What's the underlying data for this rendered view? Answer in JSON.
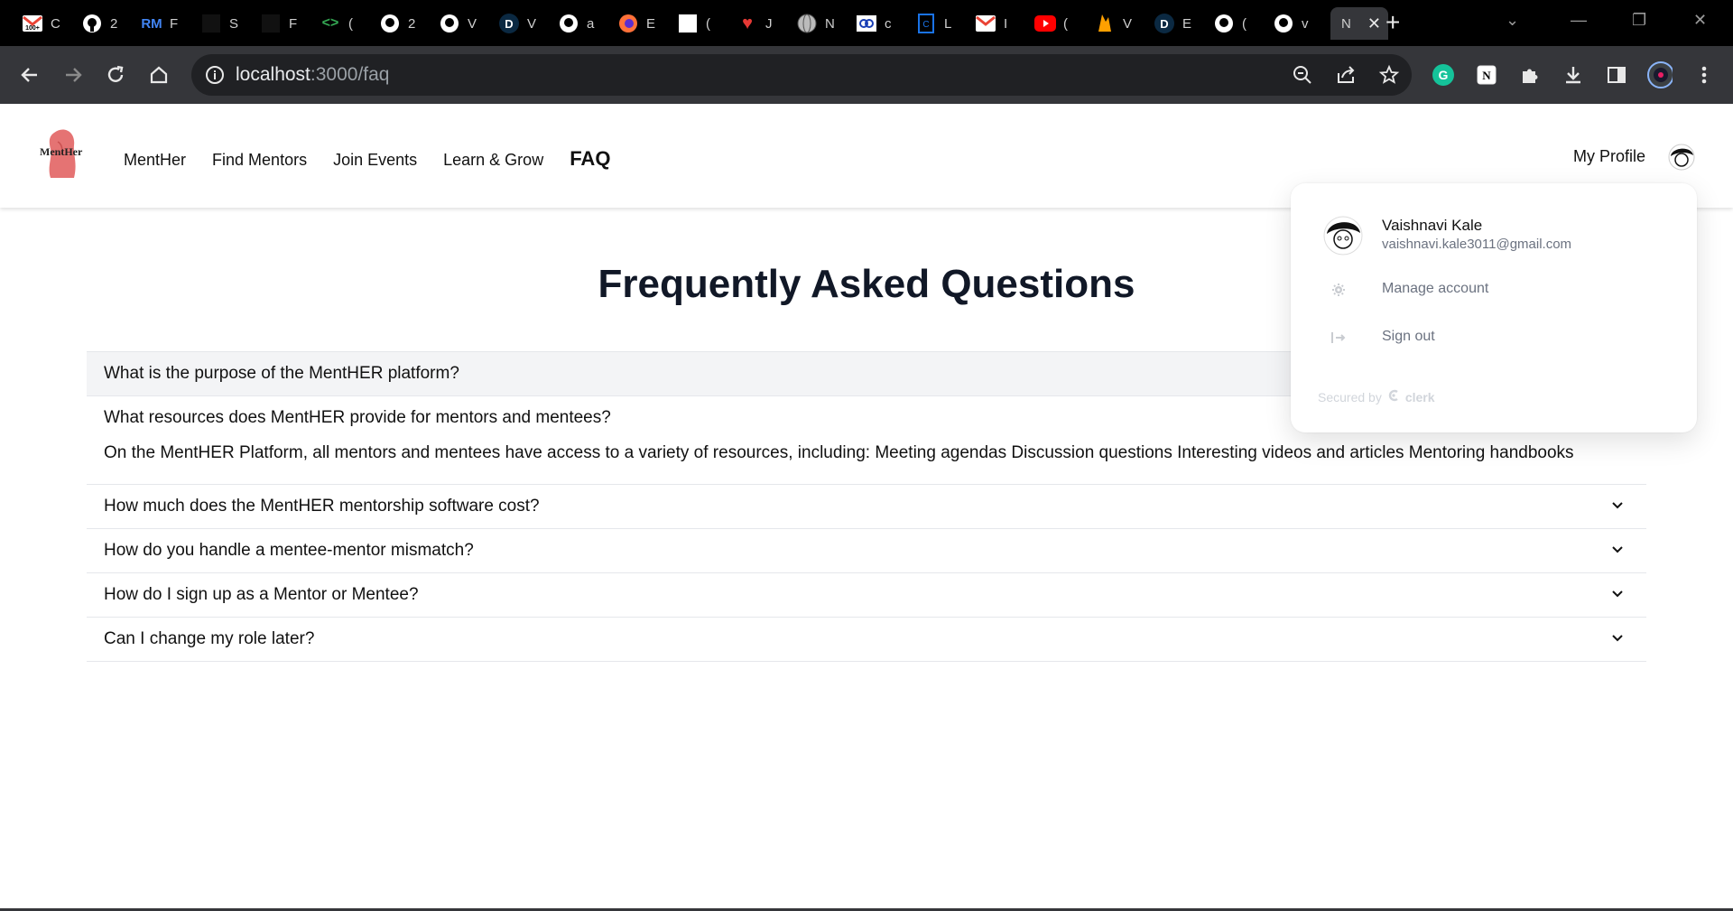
{
  "browser": {
    "tabs": [
      {
        "icon": "gmail-icon",
        "title": "C"
      },
      {
        "icon": "github-icon",
        "title": "2"
      },
      {
        "icon": "rm-icon",
        "title": "F"
      },
      {
        "icon": "dark-page-icon",
        "title": "S"
      },
      {
        "icon": "dark-page-icon",
        "title": "F"
      },
      {
        "icon": "code-brackets-icon",
        "title": "("
      },
      {
        "icon": "github-icon",
        "title": "2"
      },
      {
        "icon": "github-icon",
        "title": "V"
      },
      {
        "icon": "d-icon",
        "title": "V"
      },
      {
        "icon": "github-icon",
        "title": "a"
      },
      {
        "icon": "firefox-icon",
        "title": "E"
      },
      {
        "icon": "white-square-icon",
        "title": "("
      },
      {
        "icon": "heart-icon",
        "title": "J"
      },
      {
        "icon": "globe-icon",
        "title": "N"
      },
      {
        "icon": "screen-share-icon",
        "title": "c"
      },
      {
        "icon": "doc-icon",
        "title": "L"
      },
      {
        "icon": "gmail-icon",
        "title": "I"
      },
      {
        "icon": "youtube-icon",
        "title": "("
      },
      {
        "icon": "firebase-icon",
        "title": "V"
      },
      {
        "icon": "d-icon",
        "title": "E"
      },
      {
        "icon": "github-icon",
        "title": "("
      },
      {
        "icon": "github-icon",
        "title": "v"
      }
    ],
    "active_tab": {
      "title": "N"
    },
    "url_host": "localhost",
    "url_path": ":3000/faq"
  },
  "nav": {
    "logo_text": "MentHer",
    "links": [
      "MentHer",
      "Find Mentors",
      "Join Events",
      "Learn & Grow",
      "FAQ"
    ],
    "profile_label": "My Profile"
  },
  "page": {
    "heading": "Frequently Asked Questions"
  },
  "faqs": [
    {
      "question": "What is the purpose of the MentHER platform?",
      "open": false
    },
    {
      "question": "What resources does MentHER provide for mentors and mentees?",
      "open": true,
      "answer": "On the MentHER Platform, all mentors and mentees have access to a variety of resources, including: Meeting agendas Discussion questions Interesting videos and articles Mentoring handbooks"
    },
    {
      "question": "How much does the MentHER mentorship software cost?",
      "open": false
    },
    {
      "question": "How do you handle a mentee-mentor mismatch?",
      "open": false
    },
    {
      "question": "How do I sign up as a Mentor or Mentee?",
      "open": false
    },
    {
      "question": "Can I change my role later?",
      "open": false
    }
  ],
  "user_menu": {
    "name": "Vaishnavi Kale",
    "email": "vaishnavi.kale3011@gmail.com",
    "manage_label": "Manage account",
    "signout_label": "Sign out",
    "secured_by": "Secured by",
    "clerk_label": "clerk"
  },
  "colors": {
    "tab_strip": "#000000",
    "toolbar": "#35363a",
    "heading": "#111827",
    "accent_logo": "#e57373"
  }
}
